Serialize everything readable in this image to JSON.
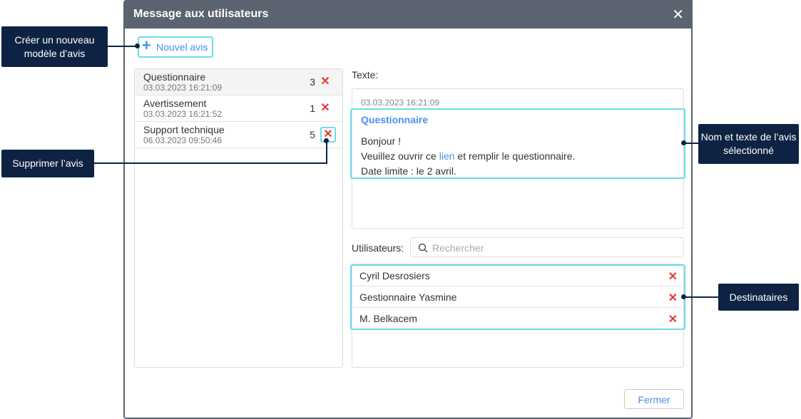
{
  "dialog": {
    "title": "Message aux utilisateurs",
    "new_label": "Nouvel avis",
    "text_label": "Texte:",
    "users_label": "Utilisateurs:",
    "search_placeholder": "Rechercher",
    "close_label": "Fermer"
  },
  "notices": [
    {
      "name": "Questionnaire",
      "date": "03.03.2023 16:21:09",
      "count": "3"
    },
    {
      "name": "Avertissement",
      "date": "03.03.2023 16:21:52",
      "count": "1"
    },
    {
      "name": "Support technique",
      "date": "06.03.2023 09:50:46",
      "count": "5"
    }
  ],
  "message": {
    "date": "03.03.2023 16:21:09",
    "title": "Questionnaire",
    "line1": "Bonjour !",
    "line2_pre": "Veuillez ouvrir ce ",
    "line2_link": "lien",
    "line2_post": " et remplir le questionnaire.",
    "line3": "Date limite : le 2 avril."
  },
  "users": [
    "Cyril Desrosiers",
    "Gestionnaire Yasmine",
    "M. Belkacem"
  ],
  "callouts": {
    "create": "Créer un nouveau modèle d’avis",
    "delete": "Supprimer l’avis",
    "selected": "Nom et texte de l’avis sélectionné",
    "recipients": "Destinataires"
  },
  "colors": {
    "accent": "#4a8ff0",
    "highlight": "#6ddcec",
    "callout": "#0e2343",
    "delete": "#e53935"
  }
}
